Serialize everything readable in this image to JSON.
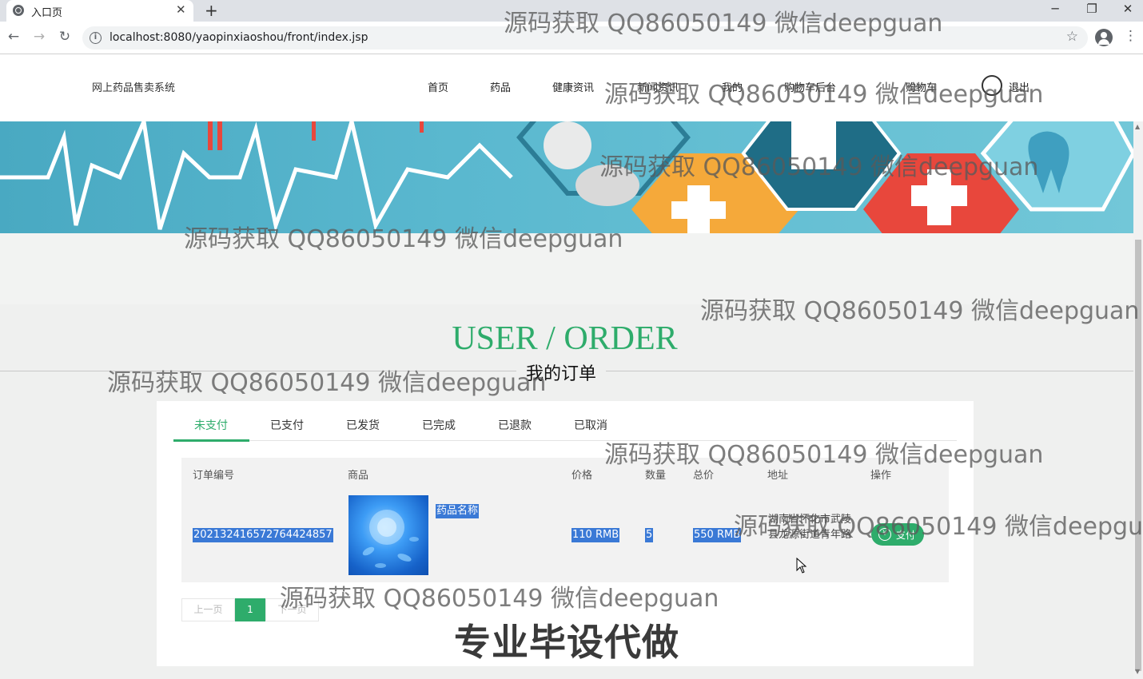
{
  "browser": {
    "tab_title": "入口页",
    "new_tab": "+",
    "close": "✕",
    "url": "localhost:8080/yaopinxiaoshou/front/index.jsp",
    "controls": {
      "minimize": "─",
      "restore": "❐",
      "close": "✕"
    }
  },
  "header": {
    "site_title": "网上药品售卖系统",
    "nav": [
      "首页",
      "药品",
      "健康资讯",
      "新闻资讯",
      "我的",
      "购物车后台",
      "购物车",
      "退出"
    ]
  },
  "section": {
    "title_en": "USER / ORDER",
    "title_cn": "我的订单"
  },
  "order_tabs": {
    "items": [
      "未支付",
      "已支付",
      "已发货",
      "已完成",
      "已退款",
      "已取消"
    ],
    "active_index": 0
  },
  "table": {
    "headers": [
      "订单编号",
      "商品",
      "价格",
      "数量",
      "总价",
      "地址",
      "操作"
    ],
    "rows": [
      {
        "order_no": "20213241657276442 4857",
        "product_name": "药品名称",
        "price": "110 RMB",
        "quantity": "5",
        "total": "550 RMB",
        "address": "湖南省怀化市武陵县龙源街道青年路",
        "action": "支付"
      }
    ]
  },
  "pagination": {
    "prev": "上一页",
    "current": "1",
    "next": "下一页"
  },
  "watermark": "源码获取 QQ86050149 微信deepguan",
  "ad_text": "专业毕设代做",
  "colors": {
    "accent": "#2eac6b",
    "selection": "#3a79d6"
  }
}
